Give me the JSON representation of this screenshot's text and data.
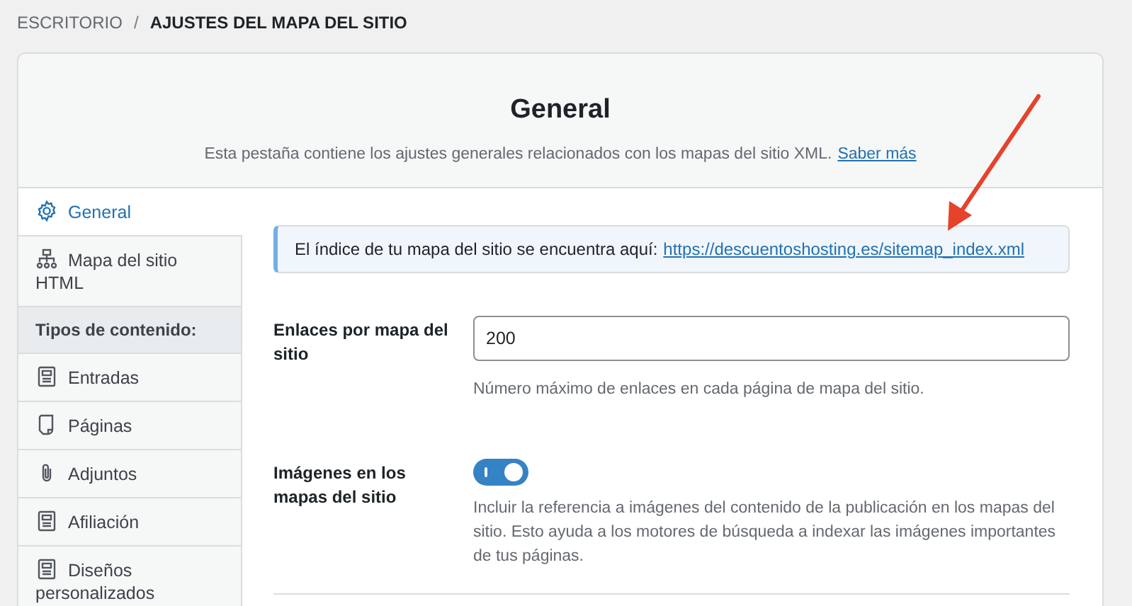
{
  "breadcrumb": [
    {
      "label": "ESCRITORIO",
      "current": false
    },
    {
      "label": "AJUSTES DEL MAPA DEL SITIO",
      "current": true
    }
  ],
  "breadcrumb_separator": "/",
  "header": {
    "title": "General",
    "description": "Esta pestaña contiene los ajustes generales relacionados con los mapas del sitio XML.",
    "link": "Saber más"
  },
  "sidebar": {
    "items": [
      {
        "kind": "gear",
        "label": "General",
        "selected": true
      },
      {
        "kind": "sitemap",
        "label": "Mapa del sitio HTML",
        "selected": false
      },
      {
        "kind": "heading",
        "label": "Tipos de contenido:"
      },
      {
        "kind": "post",
        "label": "Entradas",
        "selected": false
      },
      {
        "kind": "page",
        "label": "Páginas",
        "selected": false
      },
      {
        "kind": "attachment",
        "label": "Adjuntos",
        "selected": false
      },
      {
        "kind": "post",
        "label": "Afiliación",
        "selected": false
      },
      {
        "kind": "post",
        "label": "Diseños personalizados",
        "selected": false
      }
    ]
  },
  "notice": {
    "text": "El índice de tu mapa del sitio se encuentra aquí:",
    "link": "https://descuentoshosting.es/sitemap_index.xml"
  },
  "settings": [
    {
      "kind": "number",
      "label": "Enlaces por mapa del sitio",
      "value": "200",
      "help": "Número máximo de enlaces en cada página de mapa del sitio."
    },
    {
      "kind": "toggle",
      "label": "Imágenes en los mapas del sitio",
      "on": true,
      "help": "Incluir la referencia a imágenes del contenido de la publicación en los mapas del sitio. Esto ayuda a los motores de búsqueda a indexar las imágenes importantes de tus páginas."
    }
  ]
}
